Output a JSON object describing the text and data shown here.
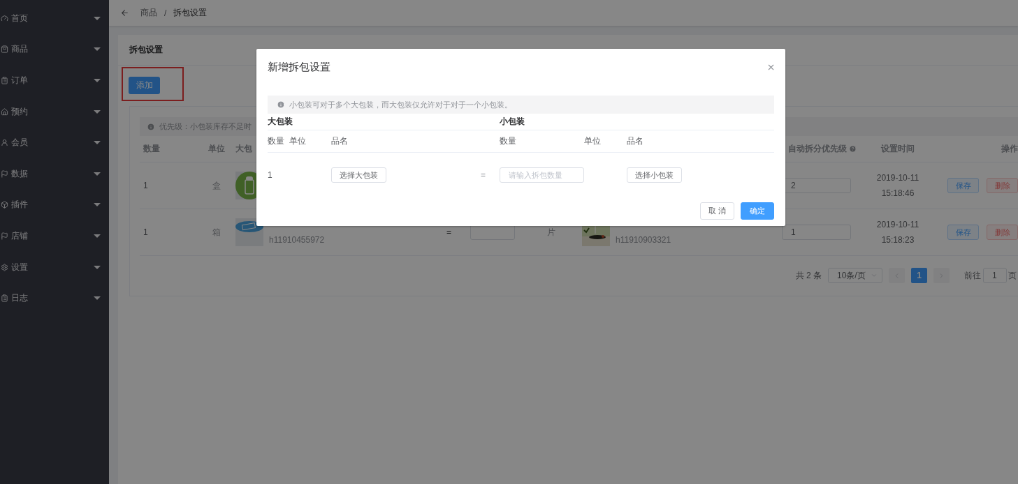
{
  "sidebar": {
    "items": [
      {
        "label": "首页"
      },
      {
        "label": "商品"
      },
      {
        "label": "订单"
      },
      {
        "label": "预约"
      },
      {
        "label": "会员"
      },
      {
        "label": "数据"
      },
      {
        "label": "插件"
      },
      {
        "label": "店铺"
      },
      {
        "label": "设置"
      },
      {
        "label": "日志"
      }
    ]
  },
  "breadcrumb": {
    "items": [
      "商品",
      "拆包设置"
    ],
    "separator": "/"
  },
  "card": {
    "title": "拆包设置",
    "add_button": "添加"
  },
  "table": {
    "notice": "优先级：小包装库存不足时",
    "columns": [
      {
        "label": "数量",
        "kind": "plain"
      },
      {
        "label": "单位",
        "kind": "plain"
      },
      {
        "label": "大包",
        "kind": "plain"
      },
      {
        "label": "自动拆分优先级",
        "kind": "help"
      },
      {
        "label": "设置时间",
        "kind": "plain"
      },
      {
        "label": "操作",
        "kind": "plain"
      }
    ],
    "rows": [
      {
        "quantity": "1",
        "unit": "盒",
        "priority": "2",
        "date": "2019-10-11",
        "time": "15:18:46",
        "save": "保存",
        "delete": "删除"
      },
      {
        "quantity": "1",
        "unit": "箱",
        "big_code": "h11910455972",
        "equals": "=",
        "small_unit": "片",
        "small_code": "h11910903321",
        "priority": "1",
        "date": "2019-10-11",
        "time": "15:18:23",
        "save": "保存",
        "delete": "删除"
      }
    ]
  },
  "pagination": {
    "total": "共 2 条",
    "page_size": "10条/页",
    "pages": [
      {
        "label": "1",
        "selected": true
      }
    ],
    "goto_label": "前往",
    "goto_value": "1",
    "page_suffix": "页"
  },
  "modal": {
    "title": "新增拆包设置",
    "notice": "小包装可对于多个大包装，而大包装仅允许对于对于一个小包装。",
    "big_heading": "大包装",
    "small_heading": "小包装",
    "columns": [
      "数量",
      "单位",
      "品名",
      "数量",
      "单位",
      "品名"
    ],
    "row": {
      "quantity": "1",
      "big_button": "选择大包装",
      "equals": "=",
      "placeholder": "请输入拆包数量",
      "small_button": "选择小包装"
    },
    "cancel": "取 消",
    "confirm": "确定"
  }
}
